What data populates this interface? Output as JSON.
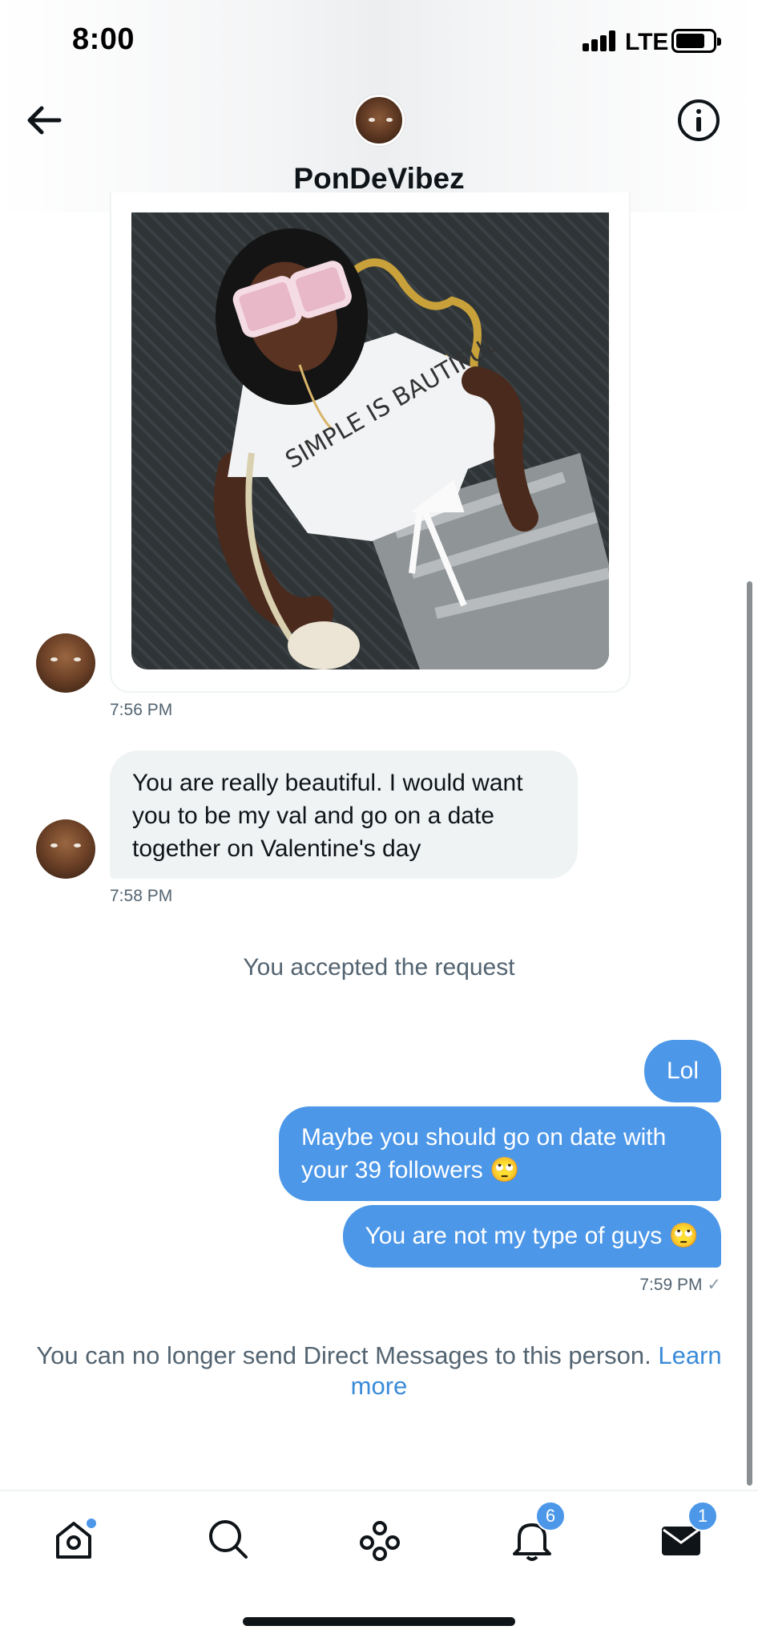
{
  "status_bar": {
    "time": "8:00",
    "network": "LTE",
    "battery_level": 0.8
  },
  "header": {
    "back_icon": "arrow-left-icon",
    "title": "PonDeVibez",
    "info_icon": "info-icon"
  },
  "messages": {
    "photo_time": "7:56 PM",
    "photo_shirt_text": "SIMPLE IS BAUTIFUL",
    "incoming_text": "You are really beautiful. I would want you to be my val and go on a date together on Valentine's day",
    "incoming_time": "7:58 PM",
    "system_text": "You accepted the request",
    "outgoing": [
      {
        "text": "Lol"
      },
      {
        "text": "Maybe you should go on date with your 39 followers 🙄"
      },
      {
        "text": "You are not my type of guys 🙄"
      }
    ],
    "outgoing_time": "7:59 PM",
    "read_mark": "✓"
  },
  "notice": {
    "text": "You can no longer send Direct Messages to this person.",
    "link": "Learn more"
  },
  "tabbar": {
    "home_icon": "home-icon",
    "search_icon": "search-icon",
    "spaces_icon": "communities-icon",
    "notifications_icon": "bell-icon",
    "notifications_count": "6",
    "messages_icon": "mail-icon",
    "messages_count": "1"
  },
  "colors": {
    "accent": "#4c97e8",
    "incoming_bubble": "#eff3f4",
    "muted_text": "#536471"
  }
}
